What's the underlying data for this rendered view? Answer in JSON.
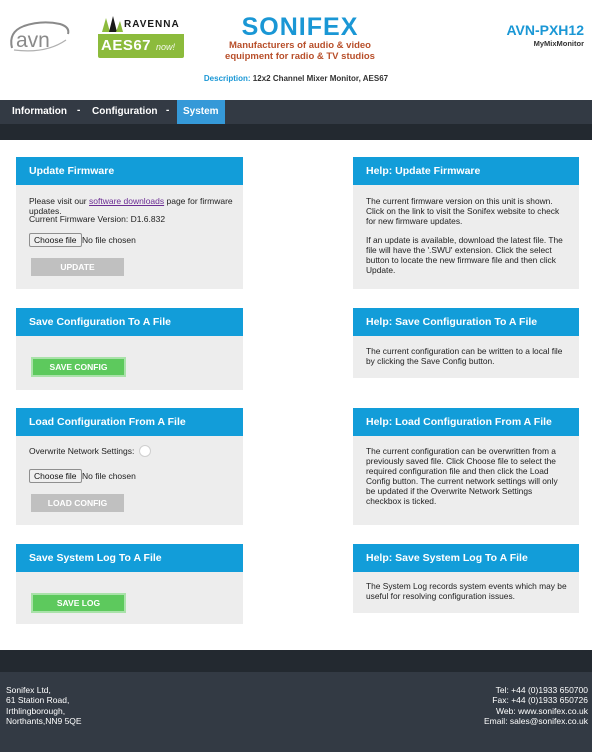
{
  "header": {
    "avn_logo": "avn",
    "ravenna_logo": {
      "wordmark": "RAVENNA",
      "aes": "AES67",
      "now": "now!"
    },
    "sonifex_logo": {
      "name": "SONIFEX",
      "tagline_line1": "Manufacturers of audio & video",
      "tagline_line2": "equipment for radio & TV studios"
    },
    "model_name": "AVN-PXH12",
    "device_name": "MyMixMonitor",
    "description_label": "Description:",
    "description_value": "12x2 Channel Mixer Monitor, AES67",
    "colors": {
      "brand_blue": "#1a97d5",
      "tagline_brown": "#b84f2a",
      "ravenna_green": "#8cbb3c"
    }
  },
  "nav": {
    "items": [
      {
        "label": "Information",
        "active": false
      },
      {
        "label": "Configuration",
        "active": false
      },
      {
        "label": "System",
        "active": true
      }
    ],
    "separator": "-"
  },
  "panels": {
    "update_firmware": {
      "title": "Update Firmware",
      "visit_prefix": "Please visit our ",
      "visit_link": "software downloads",
      "visit_suffix": " page for firmware updates.",
      "version_label": "Current Firmware Version: ",
      "version_value": "D1.6.832",
      "choose_file_label": "Choose file",
      "no_file_label": "No file chosen",
      "update_button": "UPDATE"
    },
    "help_update_firmware": {
      "title": "Help: Update Firmware",
      "para1": "The current firmware version on this unit is shown. Click on the link to visit the Sonifex website to check for new firmware updates.",
      "para2": "If an update is available, download the latest file. The file will have the '.SWU' extension. Click the select button to locate the new firmware file and then click Update."
    },
    "save_config": {
      "title": "Save Configuration To A File",
      "save_button": "SAVE CONFIG"
    },
    "help_save_config": {
      "title": "Help: Save Configuration To A File",
      "para1": "The current configuration can be written to a local file by clicking the Save Config button."
    },
    "load_config": {
      "title": "Load Configuration From A File",
      "overwrite_label": "Overwrite Network Settings:",
      "choose_file_label": "Choose file",
      "no_file_label": "No file chosen",
      "load_button": "LOAD CONFIG"
    },
    "help_load_config": {
      "title": "Help: Load Configuration From A File",
      "para1": "The current configuration can be overwritten from a previously saved file. Click Choose file to select the required configuration file and then click the Load Config button. The current network settings will only be updated if the Overwrite Network Settings checkbox is ticked."
    },
    "save_log": {
      "title": "Save System Log To A File",
      "save_button": "SAVE LOG"
    },
    "help_save_log": {
      "title": "Help: Save System Log To A File",
      "para1": "The System Log records system events which may be useful for resolving configuration issues."
    }
  },
  "footer": {
    "address": [
      "Sonifex Ltd,",
      "61 Station Road,",
      "Irthlingborough,",
      "Northants,NN9 5QE"
    ],
    "contact": [
      "Tel: +44 (0)1933 650700",
      "Fax: +44 (0)1933 650726",
      "Web: www.sonifex.co.uk",
      "Email: sales@sonifex.co.uk"
    ]
  }
}
